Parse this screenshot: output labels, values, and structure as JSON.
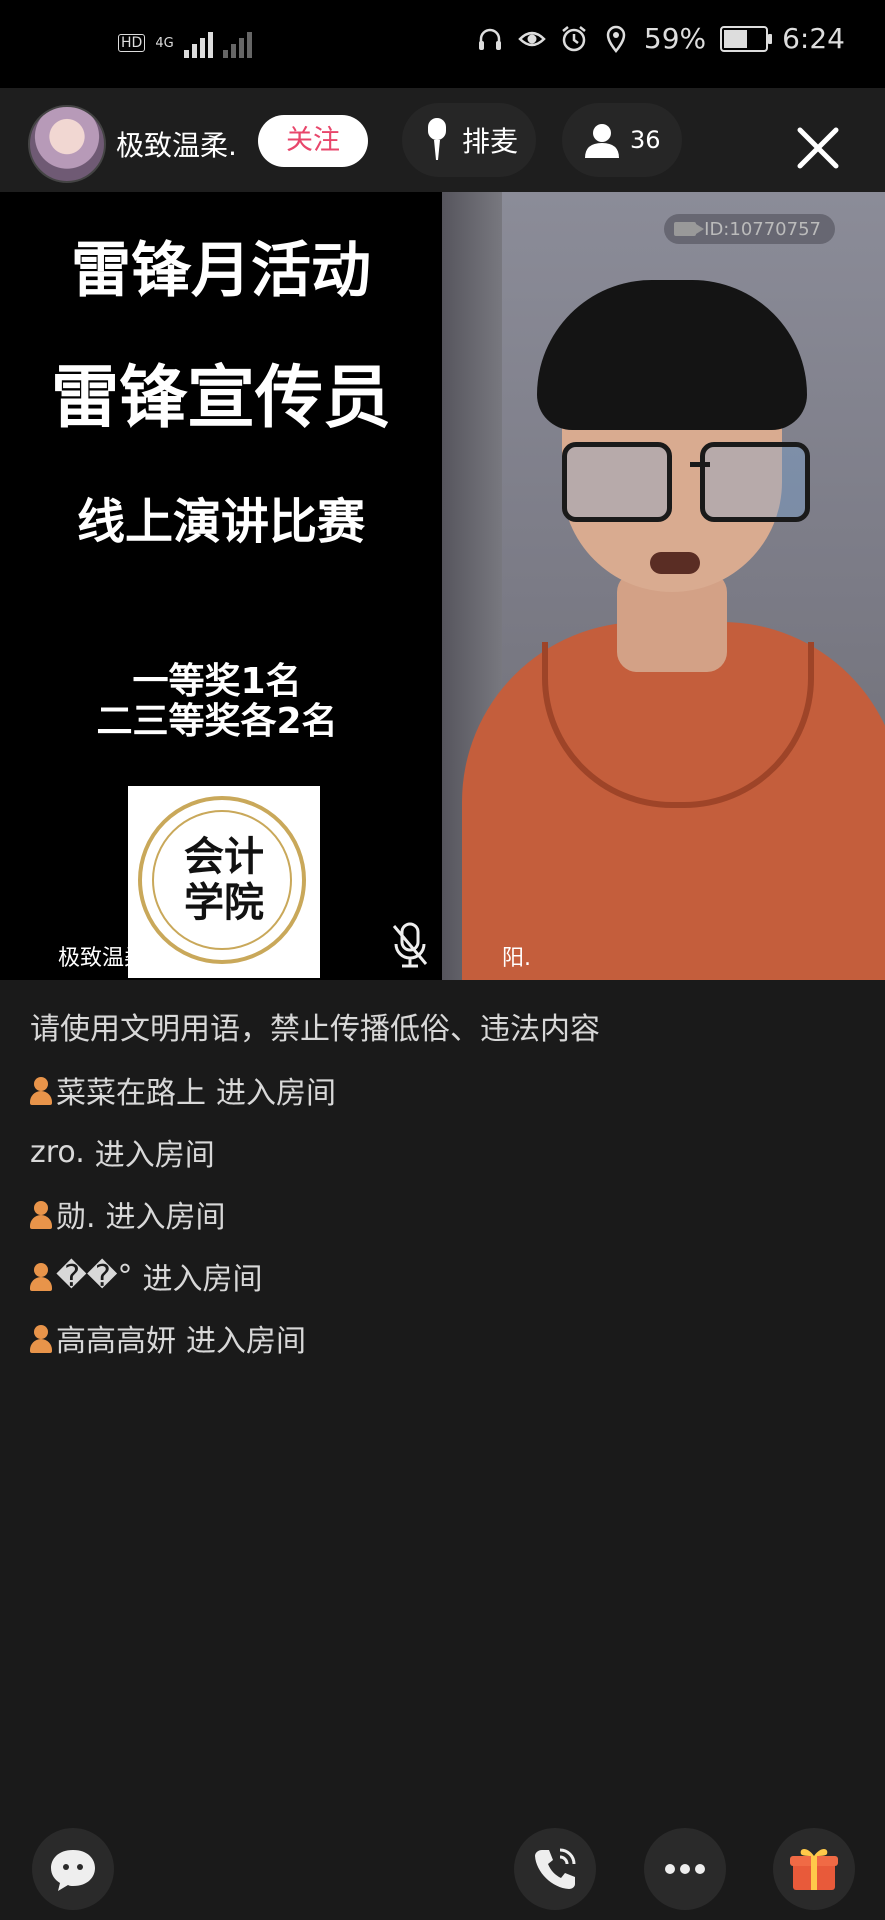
{
  "status_bar": {
    "hd_label": "HD",
    "network_label": "4G",
    "battery": "59%",
    "battery_level": 0.59,
    "time": "6:24"
  },
  "top_bar": {
    "host_name": "极致温柔.",
    "follow_label": "关注",
    "queue_label": "排麦",
    "viewer_count": "36"
  },
  "video": {
    "poster": {
      "line1": "雷锋月活动",
      "line2": "雷锋宣传员",
      "line3": "线上演讲比赛",
      "prize1": "一等奖1名",
      "prize2": "二三等奖各2名",
      "seal_text": "会计\n学院"
    },
    "left_label": "极致温柔.",
    "right_label": "阳.",
    "room_id": "ID:10770757"
  },
  "chat": {
    "notice": "请使用文明用语，禁止传播低俗、违法内容",
    "messages": [
      {
        "user": "菜菜在路上",
        "action": "进入房间",
        "icon": true
      },
      {
        "user": "zro.",
        "action": "进入房间",
        "icon": false
      },
      {
        "user": "勋.",
        "action": "进入房间",
        "icon": true
      },
      {
        "user": "��°",
        "action": "进入房间",
        "icon": true
      },
      {
        "user": "高高高妍",
        "action": "进入房间",
        "icon": true
      }
    ]
  },
  "bottom_bar": {
    "icons": [
      "chat-bubble-icon",
      "phone-icon",
      "more-icon",
      "gift-icon"
    ]
  }
}
